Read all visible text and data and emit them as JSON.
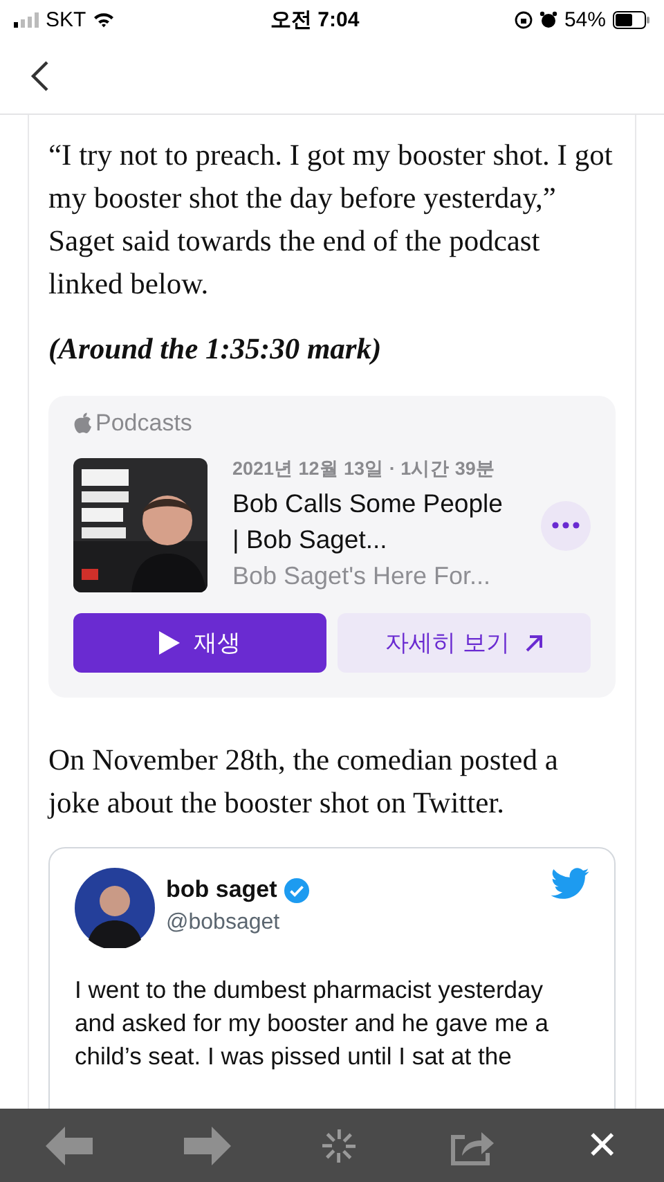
{
  "status_bar": {
    "carrier": "SKT",
    "time": "오전 7:04",
    "battery": "54%"
  },
  "article": {
    "quote": "“I try not to preach. I got my booster shot. I got my booster shot the day before yesterday,” Saget said towards the end of the podcast linked below.",
    "note": "(Around the 1:35:30 mark)",
    "podcast": {
      "brand": "Podcasts",
      "meta": "2021년 12월 13일 · 1시간 39분",
      "title": "Bob Calls Some People | Bob Saget...",
      "show": "Bob Saget's Here For...",
      "play": "재생",
      "details": "자세히 보기"
    },
    "paragraph": "On November 28th, the comedian posted a joke about the booster shot on Twitter.",
    "tweet": {
      "name": "bob saget",
      "verified": true,
      "handle": "@bobsaget",
      "text": "I went to the dumbest pharmacist yesterday and asked for my booster and he gave me a child’s seat. I was pissed until I sat at the"
    }
  },
  "toolbar": {
    "close": "✕"
  }
}
